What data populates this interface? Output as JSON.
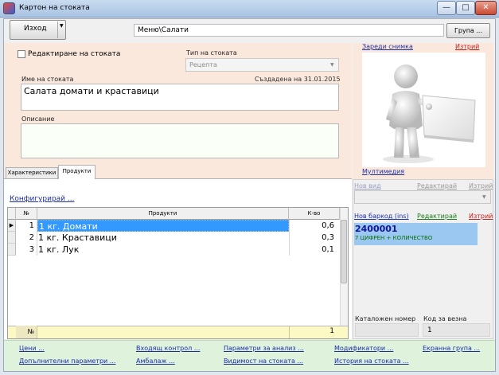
{
  "window": {
    "title": "Картон на стоката",
    "min_glyph": "—",
    "max_glyph": "□",
    "close_glyph": "✕"
  },
  "toolbar": {
    "exit_label": "Изход",
    "path_value": "Меню\\Салати",
    "group_label": "Група ..."
  },
  "form": {
    "edit_label": "Редактиране на стоката",
    "type_label": "Тип на стоката",
    "type_value": "Рецепта",
    "name_label": "Име на стоката",
    "created_label": "Създадена на 31.01.2015",
    "name_value": "Салата домати и краставици",
    "desc_label": "Описание",
    "desc_value": ""
  },
  "photo": {
    "load_label": "Зареди снимка",
    "delete_label": "Изтрий",
    "multimedia_label": "Мултимедия"
  },
  "tabs": [
    {
      "label": "Характеристики"
    },
    {
      "label": "Продукти"
    }
  ],
  "products": {
    "configure_label": "Конфигурирай ...",
    "headers": {
      "no": "№",
      "product": "Продукти",
      "qty": "К-во"
    },
    "rows": [
      {
        "no": "1",
        "product": "1 кг. Домати",
        "qty": "0,6"
      },
      {
        "no": "2",
        "product": "1 кг. Краставици",
        "qty": "0,3"
      },
      {
        "no": "3",
        "product": "1 кг. Лук",
        "qty": "0,1"
      }
    ],
    "footer_no": "№",
    "footer_qty": "1"
  },
  "right_panel": {
    "new_kind": "Нов вид",
    "edit_kind": "Редактирай",
    "delete_kind": "Изтрий",
    "new_barcode": "Нов баркод (ins)",
    "edit_barcode": "Редактирай",
    "delete_barcode": "Изтрий",
    "barcode_value": "2400001",
    "barcode_desc": "7 ЦИФРЕН + КОЛИЧЕСТВО",
    "catalog_label": "Каталожен номер",
    "catalog_value": "",
    "weight_label": "Код за везна",
    "weight_value": "1"
  },
  "bottom_links": {
    "prices": "Цени ...",
    "incoming_control": "Входящ контрол ...",
    "analysis_params": "Параметри за анализ ...",
    "modifiers": "Модификатори ...",
    "screen_group": "Екранна група ...",
    "extra_params": "Допълнителни параметри ...",
    "packaging": "Амбалаж ...",
    "visibility": "Видимост на стоката ...",
    "history": "История на стоката ..."
  },
  "colors": {
    "form_bg": "#fbe8dc",
    "selection": "#3399ff",
    "link": "#1c2fa8",
    "delete_link": "#c81e1e",
    "barcode_bg": "#9ac8f0",
    "bottom_bg": "#dff2dc"
  }
}
